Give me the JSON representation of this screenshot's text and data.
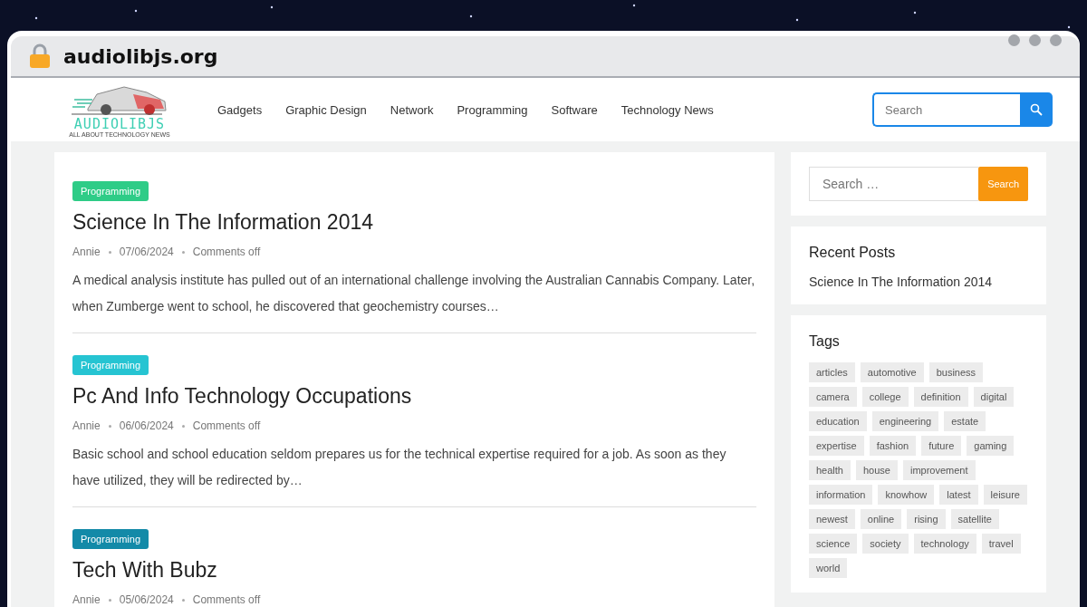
{
  "browser": {
    "address": "audiolibjs.org"
  },
  "site": {
    "logo_text": "AUDIOLIBJS",
    "logo_tagline": "ALL ABOUT TECHNOLOGY NEWS",
    "nav": [
      "Gadgets",
      "Graphic Design",
      "Network",
      "Programming",
      "Software",
      "Technology News"
    ],
    "search": {
      "placeholder": "Search"
    }
  },
  "posts": [
    {
      "category": "Programming",
      "color": "#2ecc87",
      "title": "Science In The Information 2014",
      "author": "Annie",
      "date": "07/06/2024",
      "comments": "Comments off",
      "excerpt": "A medical analysis institute has pulled out of an international challenge involving the Australian Cannabis Company. Later, when Zumberge went to school, he discovered that geochemistry courses…"
    },
    {
      "category": "Programming",
      "color": "#26c4d2",
      "title": "Pc And Info Technology Occupations",
      "author": "Annie",
      "date": "06/06/2024",
      "comments": "Comments off",
      "excerpt": "Basic school and school education seldom prepares us for the technical expertise required for a job. As soon as they have utilized, they will be redirected by…"
    },
    {
      "category": "Programming",
      "color": "#138aa8",
      "title": "Tech With Bubz",
      "author": "Annie",
      "date": "05/06/2024",
      "comments": "Comments off"
    }
  ],
  "sidebar": {
    "search": {
      "placeholder": "Search …",
      "button": "Search"
    },
    "recent": {
      "title": "Recent Posts",
      "items": [
        "Science In The Information 2014"
      ]
    },
    "tags": {
      "title": "Tags",
      "items": [
        "articles",
        "automotive",
        "business",
        "camera",
        "college",
        "definition",
        "digital",
        "education",
        "engineering",
        "estate",
        "expertise",
        "fashion",
        "future",
        "gaming",
        "health",
        "house",
        "improvement",
        "information",
        "knowhow",
        "latest",
        "leisure",
        "newest",
        "online",
        "rising",
        "satellite",
        "science",
        "society",
        "technology",
        "travel",
        "world"
      ]
    }
  }
}
